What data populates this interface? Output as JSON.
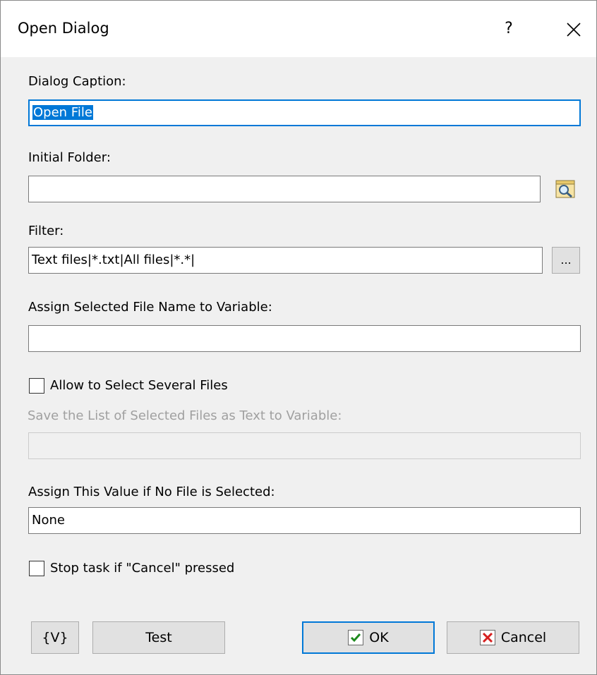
{
  "window": {
    "title": "Open Dialog",
    "help_label": "?"
  },
  "form": {
    "caption_label": "Dialog Caption:",
    "caption_value": "Open File",
    "folder_label": "Initial Folder:",
    "folder_value": "",
    "filter_label": "Filter:",
    "filter_value": "Text files|*.txt|All files|*.*|",
    "filter_button_label": "...",
    "assign_label": "Assign Selected File Name to Variable:",
    "assign_value": "",
    "multi_checkbox_label": "Allow to Select Several Files",
    "multi_checked": false,
    "save_list_label": "Save the List of Selected Files as Text to Variable:",
    "save_list_value": "",
    "no_file_label": "Assign This Value if No File is Selected:",
    "no_file_value": "None",
    "stop_checkbox_label": "Stop task if \"Cancel\" pressed",
    "stop_checked": false
  },
  "buttons": {
    "variables_label": "{V}",
    "test_label": "Test",
    "ok_label": "OK",
    "cancel_label": "Cancel"
  },
  "colors": {
    "accent": "#0078d7",
    "ok_check": "#1e8a1e",
    "cancel_x": "#d61f1f"
  }
}
